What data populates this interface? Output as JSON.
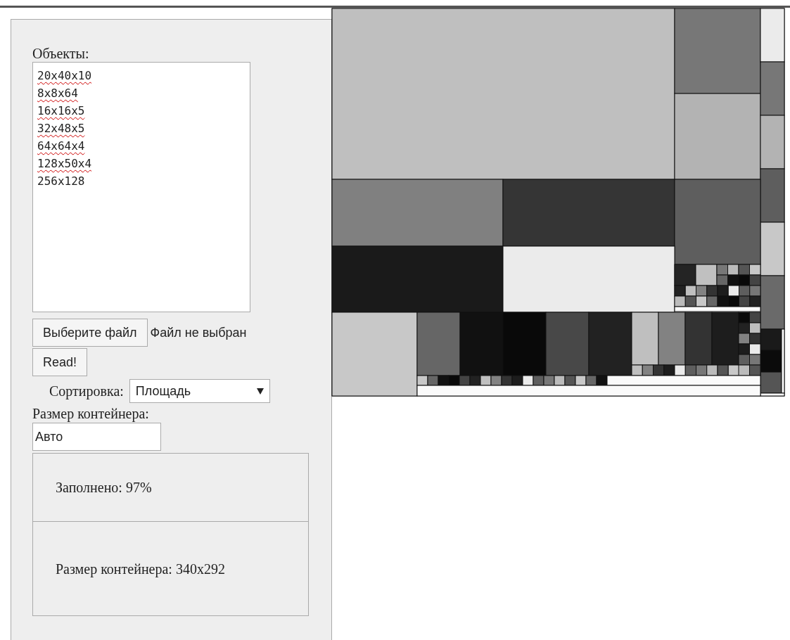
{
  "objects_label": "Объекты:",
  "objects": [
    {
      "text": "20x40x10",
      "misspelled": true
    },
    {
      "text": "8x8x64",
      "misspelled": true
    },
    {
      "text": "16x16x5",
      "misspelled": true
    },
    {
      "text": "32x48x5",
      "misspelled": true
    },
    {
      "text": "64x64x4",
      "misspelled": true
    },
    {
      "text": "128x50x4",
      "misspelled": true
    },
    {
      "text": "256x128",
      "misspelled": false
    }
  ],
  "file_button": "Выберите файл",
  "file_status": "Файл не выбран",
  "read_button": "Read!",
  "sort": {
    "label": "Сортировка:",
    "value": "Площадь"
  },
  "container_size": {
    "label": "Размер контейнера:",
    "value": "Авто"
  },
  "fill_text": "Заполнено: 97%",
  "size_text": "Размер контейнера: 340x292"
}
